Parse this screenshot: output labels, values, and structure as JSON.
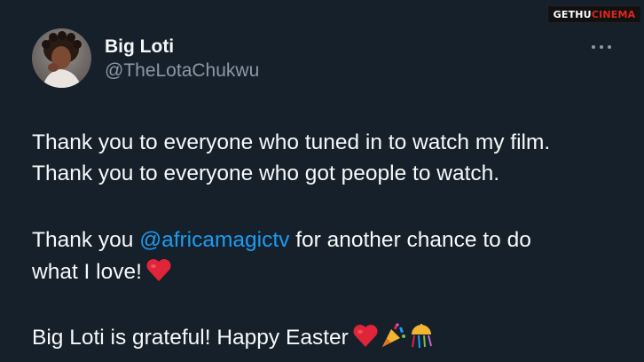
{
  "watermark": {
    "part1": "GETHU",
    "part2": "CINEMA"
  },
  "user": {
    "name": "Big Loti",
    "handle": "@TheLotaChukwu"
  },
  "tweet": {
    "line1": "Thank you to everyone who tuned in to watch my film.",
    "line2": "Thank you to everyone who got people to watch.",
    "line3_pre": "Thank you ",
    "line3_mention": "@africamagictv",
    "line3_post": " for another chance to do",
    "line4": "what I love!",
    "line5": "Big Loti is grateful! Happy Easter"
  },
  "icons": [
    "more-icon",
    "heart-emoji",
    "party-popper-emoji",
    "confetti-ball-emoji"
  ],
  "colors": {
    "background": "#15202b",
    "text": "#f7f9f9",
    "secondary": "#8b98a5",
    "link": "#1d9bf0",
    "heart": "#e0243a"
  }
}
